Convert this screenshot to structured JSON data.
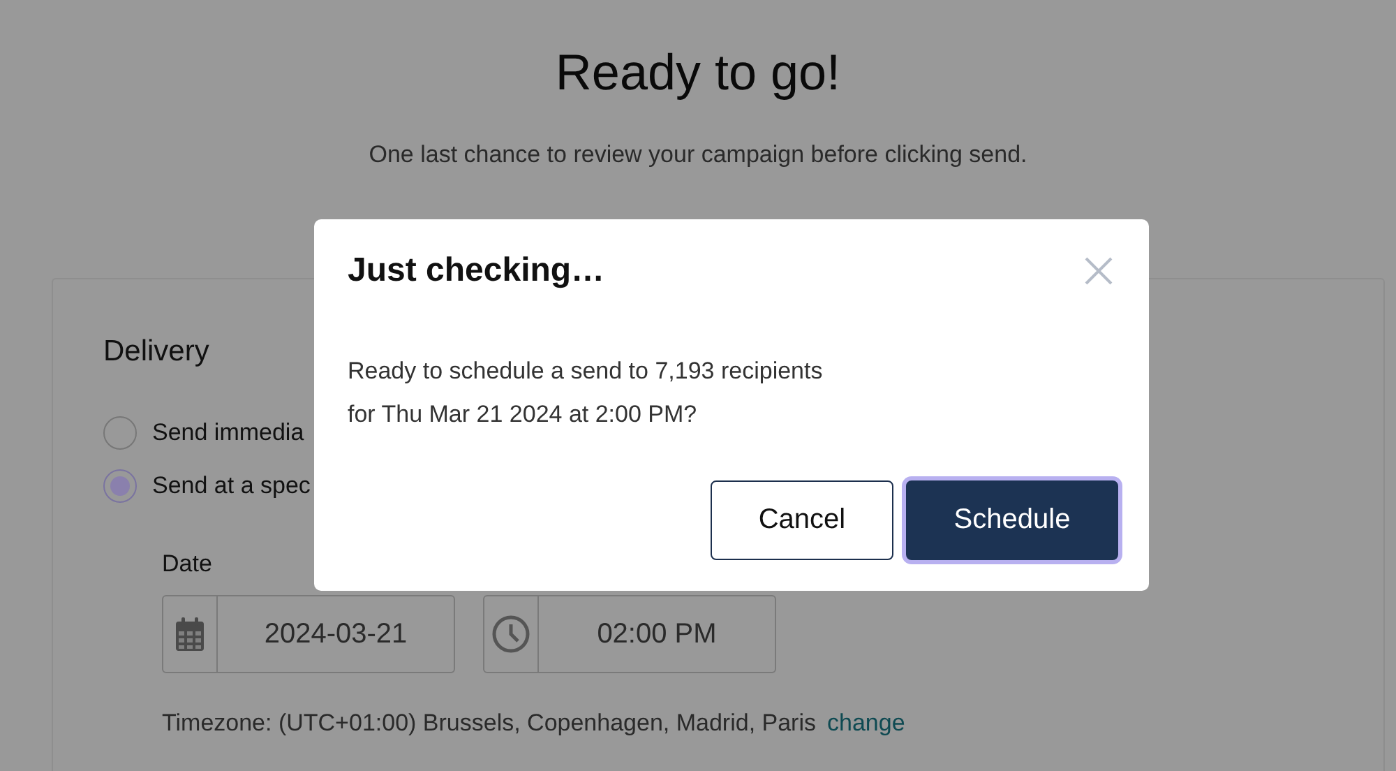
{
  "page": {
    "title": "Ready to go!",
    "subtitle": "One last chance to review your campaign before clicking send."
  },
  "delivery": {
    "heading": "Delivery",
    "options": [
      {
        "label": "Send immedia",
        "selected": false
      },
      {
        "label": "Send at a spec",
        "selected": true
      }
    ],
    "date_label": "Date",
    "date": {
      "value": "2024-03-21"
    },
    "time": {
      "value": "02:00 PM"
    },
    "timezone": "Timezone: (UTC+01:00) Brussels, Copenhagen, Madrid, Paris",
    "timezone_link": "change"
  },
  "dialog": {
    "title": "Just checking…",
    "message": [
      "Ready to schedule a send to 7,193 recipients",
      "for Thu Mar 21 2024 at 2:00 PM?"
    ],
    "buttons": [
      {
        "label": "Cancel",
        "kind": "secondary",
        "focused": false
      },
      {
        "label": "Schedule",
        "kind": "primary",
        "focused": true
      }
    ]
  }
}
